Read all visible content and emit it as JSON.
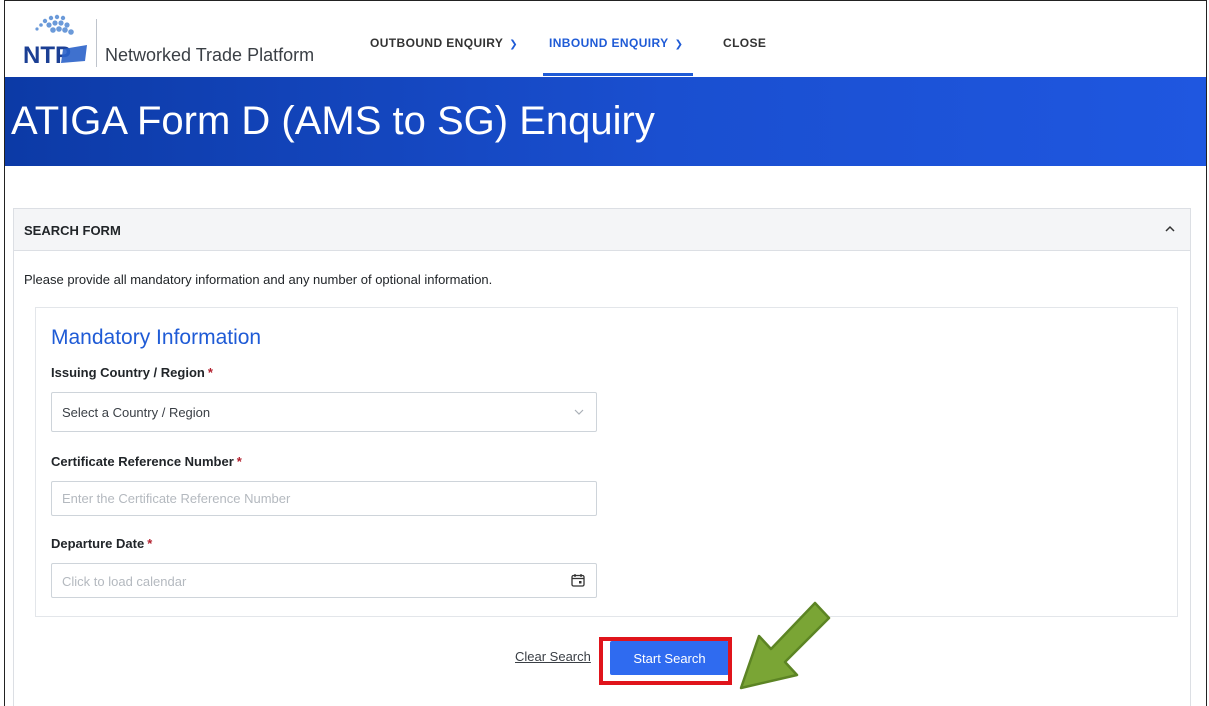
{
  "header": {
    "brand": "Networked Trade Platform",
    "logo_text": "NTP",
    "nav": [
      {
        "label": "OUTBOUND ENQUIRY",
        "has_dropdown": true,
        "active": false
      },
      {
        "label": "INBOUND ENQUIRY",
        "has_dropdown": true,
        "active": true
      },
      {
        "label": "CLOSE",
        "has_dropdown": false,
        "active": false
      }
    ]
  },
  "banner": {
    "title": "ATIGA Form D (AMS to SG) Enquiry"
  },
  "search_form": {
    "header": "SEARCH FORM",
    "instruction": "Please provide all mandatory information and any number of optional information.",
    "section_title": "Mandatory Information",
    "fields": {
      "issuing_country": {
        "label": "Issuing Country / Region",
        "required_mark": "*",
        "selected": "Select a Country / Region"
      },
      "certificate_ref": {
        "label": "Certificate Reference Number",
        "required_mark": "*",
        "placeholder": "Enter the Certificate Reference Number",
        "value": ""
      },
      "departure_date": {
        "label": "Departure Date",
        "required_mark": "*",
        "placeholder": "Click to load calendar"
      }
    },
    "actions": {
      "clear": "Clear Search",
      "start": "Start Search"
    }
  },
  "icons": {
    "nav_dropdown": "chevron-down-icon",
    "collapse": "chevron-up-icon",
    "select": "chevron-down-icon",
    "date": "calendar-icon",
    "annotation": "green-arrow-icon"
  },
  "colors": {
    "primary": "#1f5bd6",
    "banner": "#1a4fd0",
    "button": "#2f6bf0",
    "required": "#b21f2d",
    "highlight": "#e0141b",
    "arrow": "#7aa535"
  }
}
